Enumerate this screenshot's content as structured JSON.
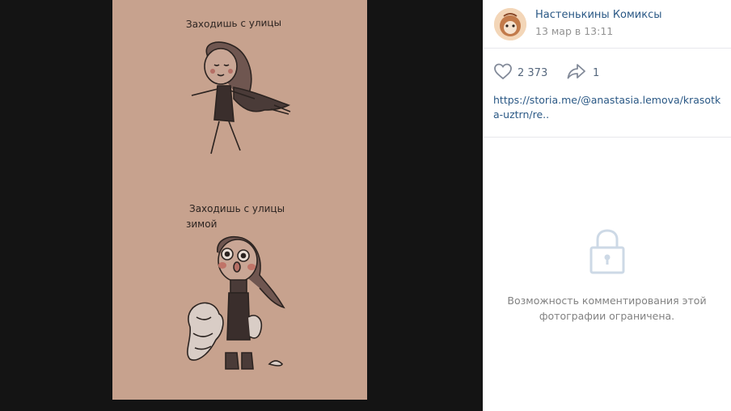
{
  "photo": {
    "caption_top": "Заходишь с улицы",
    "caption_bottom_line1": "Заходишь с улицы",
    "caption_bottom_line2": "зимой"
  },
  "author": {
    "name": "Настенькины Комиксы",
    "date": "13 мар в 13:11"
  },
  "actions": {
    "likes": "2 373",
    "shares": "1"
  },
  "link": {
    "text": "https://storia.me/@anastasia.lemova/krasotka-uztrn/re.."
  },
  "comments": {
    "restricted_line1": "Возможность комментирования этой",
    "restricted_line2": "фотографии ограничена."
  },
  "icons": {
    "like": "heart-icon",
    "share": "share-arrow-icon",
    "lock": "lock-icon"
  },
  "colors": {
    "link": "#2a5885",
    "paper": "#c7a28e",
    "backdrop": "#141414"
  }
}
